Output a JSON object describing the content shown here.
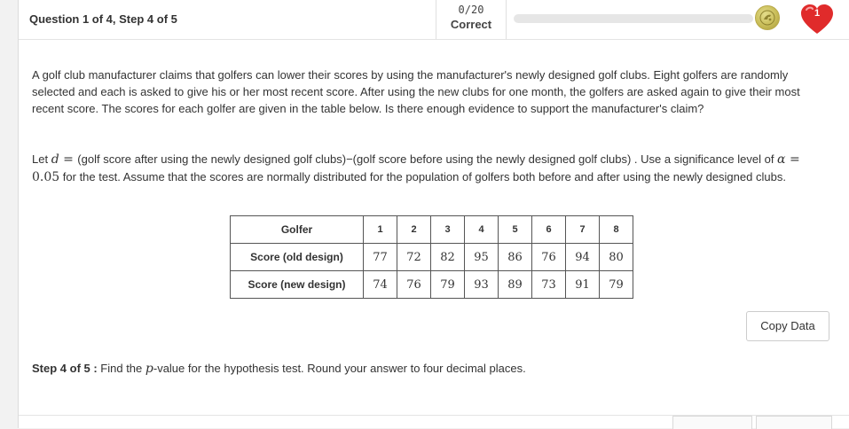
{
  "header": {
    "question_progress": "Question 1 of 4, Step 4 of 5",
    "score_count": "0/20",
    "score_label": "Correct",
    "progress_fraction": 0.0,
    "coin_icon": "golf-ball-coin-icon",
    "lives_icon": "heart-icon",
    "lives_count": "1",
    "colors": {
      "heart": "#e02b2b",
      "coin": "#c9bd58",
      "progress_track": "#e6e6e6"
    }
  },
  "problem": {
    "paragraph1": "A golf club manufacturer claims that golfers can lower their scores by using the manufacturer's newly designed golf clubs.  Eight golfers are randomly selected and each is asked to give his or her most recent score.  After using the new clubs for one month, the golfers are asked again to give their most recent score.  The scores for each golfer are given in the table below.  Is there enough evidence to support the manufacturer's claim?",
    "p2_let": "Let ",
    "p2_d": "d",
    "p2_eq": " = ",
    "p2_def": " (golf score after using the newly designed golf clubs)−(golf score before using the newly designed golf clubs) .  Use a significance level of ",
    "p2_alpha": "α",
    "p2_eq2": " = ",
    "p2_alpha_val": "0.05",
    "p2_rest": " for the test.  Assume that the scores are normally distributed for the population of golfers both before and after using the newly designed clubs."
  },
  "table": {
    "header_label": "Golfer",
    "golfers": [
      "1",
      "2",
      "3",
      "4",
      "5",
      "6",
      "7",
      "8"
    ],
    "old_label": "Score (old design)",
    "old_scores": [
      "77",
      "72",
      "82",
      "95",
      "86",
      "76",
      "94",
      "80"
    ],
    "new_label": "Score (new design)",
    "new_scores": [
      "74",
      "76",
      "79",
      "93",
      "89",
      "73",
      "91",
      "79"
    ]
  },
  "copy_button": "Copy Data",
  "step": {
    "label": "Step 4 of 5 :",
    "text_before": " Find the ",
    "p": "p",
    "text_after": "-value for the hypothesis test. Round your answer to four decimal places."
  }
}
